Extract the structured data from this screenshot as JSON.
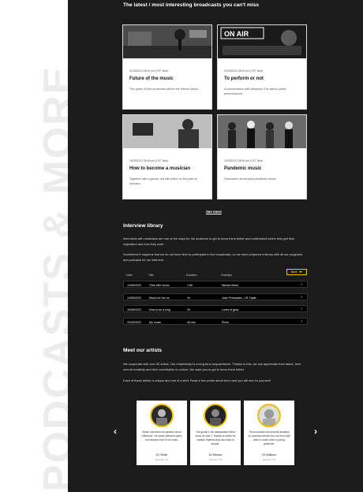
{
  "side_banner": "PODCASTS & MORE",
  "broadcasts": {
    "heading": "The latest / most interesting broadcasts you can't miss",
    "cards": [
      {
        "meta": "01/05/2022 08:40 pm (CET time)",
        "title": "Future of the music",
        "desc": "The guest of this broadcast will be the Mexico Band."
      },
      {
        "meta": "01/05/2022 08:40 pm (CET time)",
        "title": "To perform or not",
        "desc": "A conversation with Alejandro Fox about public performances."
      },
      {
        "meta": "18/05/2022 08:45 pm (CET time)",
        "title": "How to become a musician",
        "desc": "Together with a guess, we will reflect on the path to success."
      },
      {
        "meta": "20/05/2022 08:50 pm (CET time)",
        "title": "Pandemic music",
        "desc": "Discussion about post-pandemic music"
      }
    ],
    "on_air_label": "ON AIR",
    "see_more": "See more"
  },
  "library": {
    "heading": "Interview library",
    "para1": "Interviews with musicians are one of the ways for the audience to get to know them better and understand where they get their inspiration and how they work.",
    "para2": "Sometimes it happens that we do not have time to participate in live broadcasts, so we have prepared a library with all our programs and podcasts for our listeners.",
    "sort_label": "Sort",
    "columns": [
      "Date",
      "Title",
      "Duration",
      "Guest(s)"
    ],
    "rows": [
      {
        "date": "12/05/2022",
        "title": "Time with music",
        "duration": "1.5h",
        "guest": "Mexico Band"
      },
      {
        "date": "14/05/2022",
        "title": "Music for the us",
        "duration": "1h",
        "guest": "Jose Fernandez, J.R. Hyatt"
      },
      {
        "date": "16/08/2022",
        "title": "How to be a king",
        "duration": "2h",
        "guest": "Lords of glow"
      },
      {
        "date": "22/05/2022",
        "title": "My music",
        "duration": "46 min",
        "guest": "Pinko"
      }
    ]
  },
  "artists": {
    "heading": "Meet our artists",
    "para1": "We cooperate with over 50 artists. Our relationship is a long-term acquaintance. Thanks to this, we can appreciate their talent, their overall creativity and their contribution to culture. We want you to get to know them better.",
    "para2": "Each of these artists is unique and one of a kind. Read a few words about them and you will see for yourself!",
    "cards": [
      {
        "quote": "Music has been his passion since childhood. He treats different styles but remains true to his roots.",
        "name": "DJ Smith",
        "loc": "Houston, TX"
      },
      {
        "quote": "The guitar is his inseparable friend since he was 7, thanks to which he creates rhythms that are close to people.",
        "name": "DJ Mexico",
        "loc": "Houston, TX"
      },
      {
        "quote": "This musician has several decades of concerts behind him, but he is still able to move even a young audience.",
        "name": "DJ Wikison",
        "loc": "Houston, TX"
      }
    ],
    "prev_label": "‹",
    "next_label": "›"
  }
}
